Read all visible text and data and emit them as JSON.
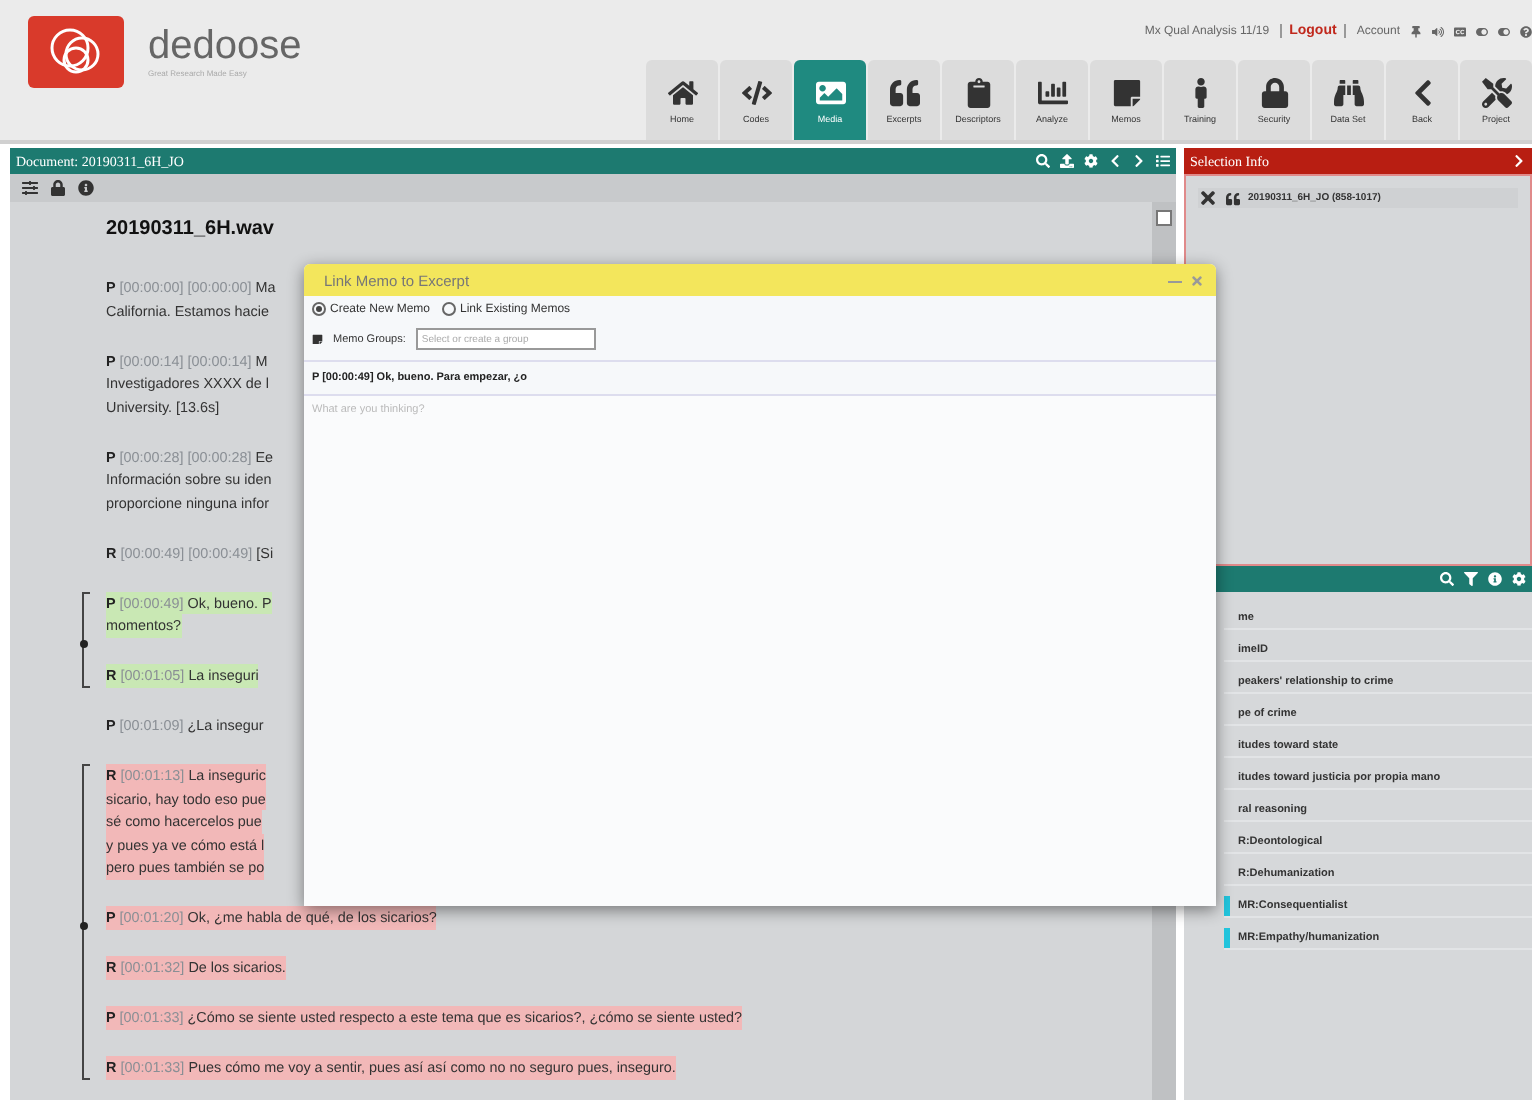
{
  "app": {
    "logo_text": "dedoose",
    "tagline": "Great Research Made Easy",
    "project": "Mx Qual Analysis 11/19",
    "logout": "Logout",
    "account": "Account"
  },
  "nav": [
    {
      "label": "Home",
      "selected": false
    },
    {
      "label": "Codes",
      "selected": false
    },
    {
      "label": "Media",
      "selected": true
    },
    {
      "label": "Excerpts",
      "selected": false
    },
    {
      "label": "Descriptors",
      "selected": false
    },
    {
      "label": "Analyze",
      "selected": false
    },
    {
      "label": "Memos",
      "selected": false
    },
    {
      "label": "Training",
      "selected": false
    },
    {
      "label": "Security",
      "selected": false
    },
    {
      "label": "Data Set",
      "selected": false
    },
    {
      "label": "Back",
      "selected": false
    },
    {
      "label": "Project",
      "selected": false
    }
  ],
  "document": {
    "title": "Document: 20190311_6H_JO",
    "filename": "20190311_6H.wav",
    "blocks": [
      {
        "kind": "paragraph",
        "speaker": "P",
        "stamp": "[00:00:00] [00:00:00]",
        "lines": [
          "Ma",
          "California. Estamos hacie"
        ]
      },
      {
        "kind": "paragraph",
        "speaker": "P",
        "stamp": "[00:00:14] [00:00:14]",
        "lines": [
          "M",
          "Investigadores XXXX de l",
          "University. [13.6s]"
        ]
      },
      {
        "kind": "paragraph",
        "speaker": "P",
        "stamp": "[00:00:28] [00:00:28]",
        "lines": [
          "Ee",
          "Información sobre su iden",
          "proporcione ninguna infor"
        ]
      },
      {
        "kind": "paragraph",
        "speaker": "R",
        "stamp": "[00:00:49] [00:00:49]",
        "lines": [
          "[Si"
        ]
      },
      {
        "kind": "group",
        "children": [
          {
            "kind": "paragraph",
            "speaker": "P",
            "stamp": "[00:00:49]",
            "color": "#c9e8b4",
            "lines": [
              "Ok, bueno. P",
              "momentos?"
            ]
          },
          {
            "kind": "paragraph",
            "speaker": "R",
            "stamp": "[00:01:05]",
            "color": "#c9e8b4",
            "lines": [
              "La inseguri"
            ]
          }
        ]
      },
      {
        "kind": "paragraph",
        "speaker": "P",
        "stamp": "[00:01:09]",
        "lines": [
          "¿La insegur"
        ]
      },
      {
        "kind": "group",
        "children": [
          {
            "kind": "paragraph",
            "speaker": "R",
            "stamp": "[00:01:13]",
            "color": "#f2b8b8",
            "lines": [
              "La inseguric",
              "sicario, hay todo eso pue",
              "sé como hacercelos pue",
              "y pues ya ve cómo está l",
              "pero pues también se po"
            ]
          },
          {
            "kind": "paragraph",
            "speaker": "P",
            "stamp": "[00:01:20]",
            "color": "#f2b8b8",
            "lines": [
              "Ok, ¿me habla de qué, de los sicarios?"
            ]
          },
          {
            "kind": "paragraph",
            "speaker": "R",
            "stamp": "[00:01:32]",
            "color": "#f2b8b8",
            "lines": [
              "De los sicarios."
            ]
          },
          {
            "kind": "paragraph",
            "speaker": "P",
            "stamp": "[00:01:33]",
            "color": "#f2b8b8",
            "lines": [
              "¿Cómo se siente usted respecto a este tema que es sicarios?, ¿cómo se siente usted?"
            ]
          },
          {
            "kind": "paragraph",
            "speaker": "R",
            "stamp": "[00:01:33]",
            "color": "#f2b8b8",
            "lines": [
              "Pues cómo me voy a sentir, pues así así como no no seguro pues, inseguro."
            ]
          }
        ]
      }
    ]
  },
  "modal": {
    "title": "Link Memo to Excerpt",
    "options": [
      {
        "label": "Create New Memo",
        "selected": true
      },
      {
        "label": "Link Existing Memos",
        "selected": false
      }
    ],
    "groups_label": "Memo Groups:",
    "groups_placeholder": "Select or create a group",
    "excerpt": "P [00:00:49] Ok, bueno. Para empezar, ¿o",
    "memo_placeholder": "What are you thinking?"
  },
  "selection_info": {
    "title": "Selection Info",
    "item": "20190311_6H_JO (858-1017)"
  },
  "codes": [
    {
      "label": "me",
      "tagged": false
    },
    {
      "label": "imeID",
      "tagged": false
    },
    {
      "label": "peakers' relationship to crime",
      "tagged": false
    },
    {
      "label": "pe of crime",
      "tagged": false
    },
    {
      "label": "itudes toward state",
      "tagged": false
    },
    {
      "label": "itudes toward justicia por propia mano",
      "tagged": false
    },
    {
      "label": "ral reasoning",
      "tagged": false
    },
    {
      "label": "R:Deontological",
      "tagged": false
    },
    {
      "label": "R:Dehumanization",
      "tagged": false
    },
    {
      "label": "MR:Consequentialist",
      "tagged": true
    },
    {
      "label": "MR:Empathy/humanization",
      "tagged": true
    }
  ]
}
